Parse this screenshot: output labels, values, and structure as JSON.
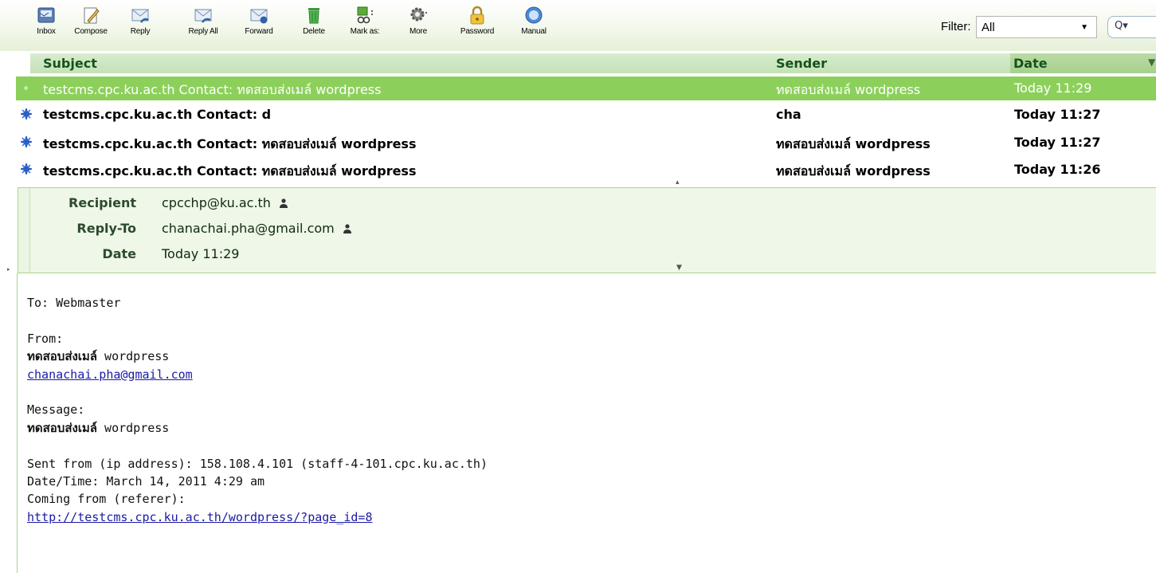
{
  "toolbar": {
    "buttons": [
      {
        "label": "Inbox",
        "icon": "inbox-icon"
      },
      {
        "label": "Compose",
        "icon": "compose-icon"
      },
      {
        "label": "Reply",
        "icon": "reply-icon"
      },
      {
        "label": "Reply All",
        "icon": "reply-all-icon"
      },
      {
        "label": "Forward",
        "icon": "forward-icon"
      },
      {
        "label": "Delete",
        "icon": "trash-icon"
      },
      {
        "label": "Mark as:",
        "icon": "mark-icon"
      },
      {
        "label": "More",
        "icon": "gear-icon"
      },
      {
        "label": "Password",
        "icon": "lock-icon"
      },
      {
        "label": "Manual",
        "icon": "help-icon"
      }
    ],
    "filter_label": "Filter:",
    "filter_value": "All"
  },
  "list": {
    "columns": {
      "subject": "Subject",
      "sender": "Sender",
      "date": "Date"
    },
    "rows": [
      {
        "subject": "testcms.cpc.ku.ac.th Contact: ทดสอบส่งเมล์  wordpress",
        "sender": "ทดสอบส่งเมล์  wordpress",
        "date": "Today 11:29"
      },
      {
        "subject": "testcms.cpc.ku.ac.th Contact: d",
        "sender": "cha",
        "date": "Today 11:27"
      },
      {
        "subject": "testcms.cpc.ku.ac.th Contact: ทดสอบส่งเมล์ wordpress",
        "sender": "ทดสอบส่งเมล์ wordpress",
        "date": "Today 11:27"
      },
      {
        "subject": "testcms.cpc.ku.ac.th Contact: ทดสอบส่งเมล์ wordpress",
        "sender": "ทดสอบส่งเมล์ wordpress",
        "date": "Today 11:26"
      }
    ]
  },
  "headers": {
    "recipient_label": "Recipient",
    "recipient_value": "cpcchp@ku.ac.th",
    "replyto_label": "Reply-To",
    "replyto_value": "chanachai.pha@gmail.com",
    "date_label": "Date",
    "date_value": "Today 11:29"
  },
  "body": {
    "to_line": "To: Webmaster",
    "from_label": "From:",
    "from_name_thai": "ทดสอบส่งเมล์",
    "from_name_rest": " wordpress",
    "from_email": "chanachai.pha@gmail.com",
    "message_label": "Message:",
    "message_thai": "ทดสอบส่งเมล์",
    "message_rest": " wordpress",
    "sent_from": "Sent from (ip address): 158.108.4.101 (staff-4-101.cpc.ku.ac.th)",
    "datetime": "Date/Time: March 14, 2011 4:29 am",
    "coming_from": "Coming from (referer):",
    "referer_url": "http://testcms.cpc.ku.ac.th/wordpress/?page_id=8"
  },
  "colors": {
    "selected_row": "#8cd05b",
    "header_text": "#15521c",
    "panel_bg": "#eef7e8",
    "link": "#1a1aa6"
  }
}
